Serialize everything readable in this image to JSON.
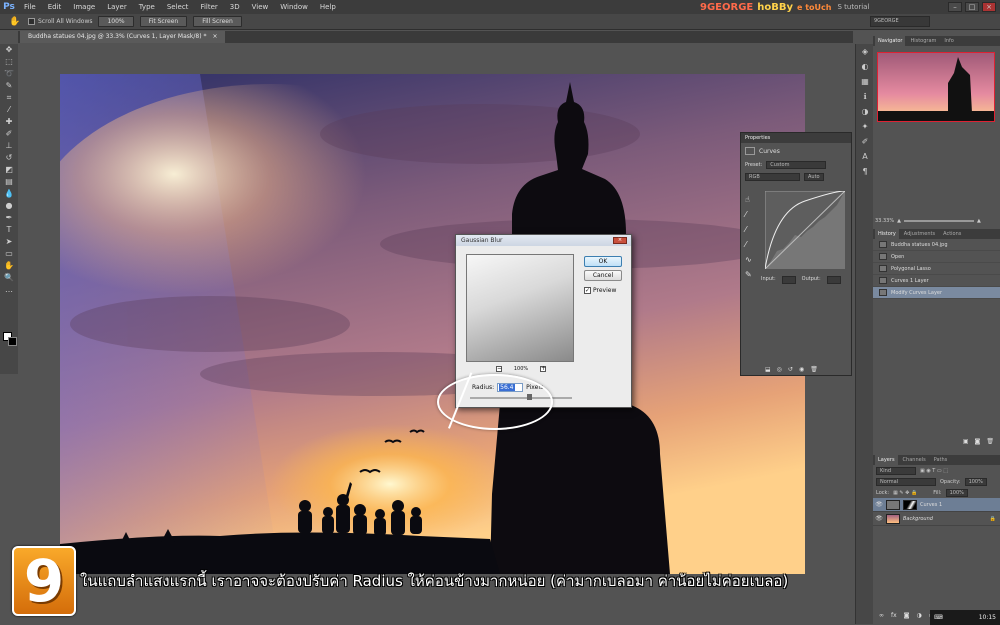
{
  "menubar": {
    "logo": "Ps",
    "items": [
      "File",
      "Edit",
      "Image",
      "Layer",
      "Type",
      "Select",
      "Filter",
      "3D",
      "View",
      "Window",
      "Help"
    ],
    "brand": [
      "9GEORGE",
      "hoBBy",
      "e toUch"
    ],
    "brand_sub": "S tutorial"
  },
  "options": {
    "scroll_all": "Scroll All Windows",
    "btn_100": "100%",
    "fit_screen": "Fit Screen",
    "fill_screen": "Fill Screen",
    "workspace": "9GEORGE"
  },
  "document": {
    "tab_label": "Buddha statues 04.jpg @ 33.3% (Curves 1, Layer Mask/8) *",
    "tab_close": "×"
  },
  "navigator": {
    "tabs": [
      "Navigator",
      "Histogram",
      "Info"
    ],
    "zoom": "33.33%"
  },
  "history": {
    "tabs": [
      "History",
      "Adjustments",
      "Actions"
    ],
    "items": [
      "Buddha statues 04.jpg",
      "Open",
      "Polygonal Lasso",
      "Curves 1 Layer",
      "Modify Curves Layer"
    ]
  },
  "properties": {
    "title": "Properties",
    "type": "Curves",
    "preset_label": "Preset:",
    "preset_value": "Custom",
    "channel": "RGB",
    "auto": "Auto",
    "input_label": "Input:",
    "output_label": "Output:"
  },
  "layers": {
    "tabs": [
      "Layers",
      "Channels",
      "Paths"
    ],
    "kind": "Kind",
    "mode": "Normal",
    "opacity_label": "Opacity:",
    "opacity": "100%",
    "lock_label": "Lock:",
    "fill_label": "Fill:",
    "fill": "100%",
    "items": [
      "Curves 1",
      "Background"
    ]
  },
  "dialog": {
    "title": "Gaussian Blur",
    "ok": "OK",
    "cancel": "Cancel",
    "preview_label": "Preview",
    "zoom": "100%",
    "radius_label": "Radius:",
    "radius_value": "56.4",
    "unit": "Pixels"
  },
  "caption": {
    "step": "9",
    "text": "ในแถบลำแสงแรกนี้ เราอาจจะต้องปรับค่า Radius ให้ค่อนข้างมากหน่อย (ค่ามากเบลอมา ค่าน้อยไม่ค่อยเบลอ)"
  },
  "taskbar": {
    "time": "10:15"
  },
  "colors": {
    "accent": "#3a6fd4",
    "badge": "#f39a1e",
    "selection": "#7a8aa0"
  }
}
